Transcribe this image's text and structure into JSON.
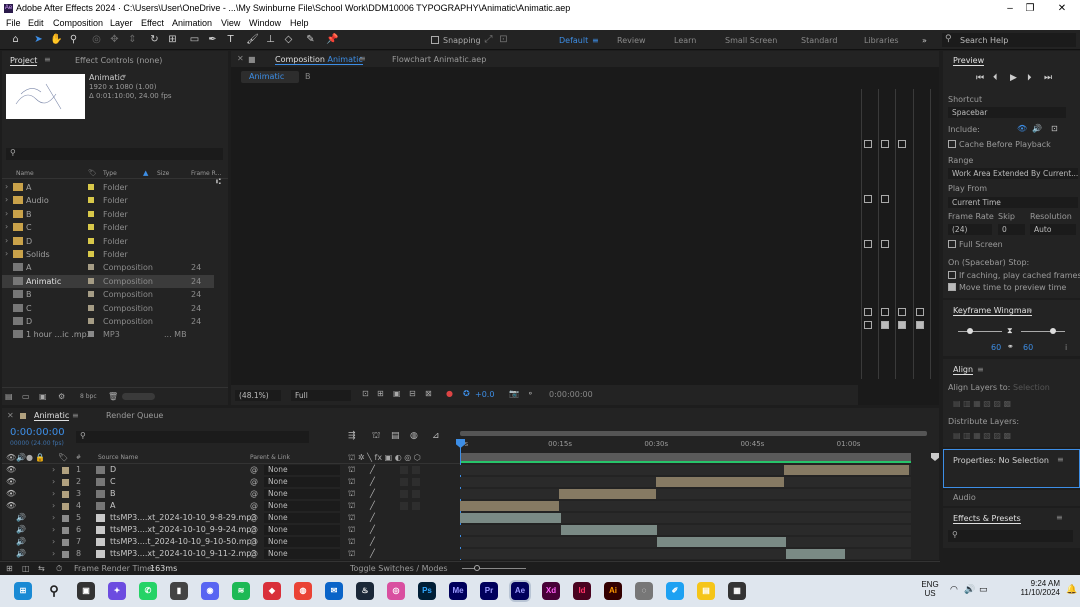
{
  "window": {
    "title": "Adobe After Effects 2024 · C:\\Users\\User\\OneDrive - ...\\My Swinburne File\\School Work\\DDM10006 TYPOGRAPHY\\Animatic\\Animatic.aep",
    "app_icon": "Ae"
  },
  "menu": [
    "File",
    "Edit",
    "Composition",
    "Layer",
    "Effect",
    "Animation",
    "View",
    "Window",
    "Help"
  ],
  "toolbar": {
    "snapping_label": "Snapping",
    "workspaces": [
      "Default",
      "Review",
      "Learn",
      "Small Screen",
      "Standard",
      "Libraries"
    ],
    "search_placeholder": "Search Help"
  },
  "project": {
    "tab_project": "Project",
    "tab_effect_controls": "Effect Controls (none)",
    "selected_name": "Animatic",
    "selected_size": "1920 x 1080 (1.00)",
    "selected_duration": "Δ 0:01:10:00, 24.00 fps",
    "columns": {
      "name": "Name",
      "type": "Type",
      "size": "Size",
      "frame_rate": "Frame R..."
    },
    "items": [
      {
        "name": "A",
        "type": "Folder",
        "rate": "",
        "size": "",
        "color": "#d8c84a",
        "kind": "folder"
      },
      {
        "name": "Audio",
        "type": "Folder",
        "rate": "",
        "size": "",
        "color": "#d8c84a",
        "kind": "folder"
      },
      {
        "name": "B",
        "type": "Folder",
        "rate": "",
        "size": "",
        "color": "#d8c84a",
        "kind": "folder"
      },
      {
        "name": "C",
        "type": "Folder",
        "rate": "",
        "size": "",
        "color": "#d8c84a",
        "kind": "folder"
      },
      {
        "name": "D",
        "type": "Folder",
        "rate": "",
        "size": "",
        "color": "#d8c84a",
        "kind": "folder"
      },
      {
        "name": "Solids",
        "type": "Folder",
        "rate": "",
        "size": "",
        "color": "#d8c84a",
        "kind": "folder"
      },
      {
        "name": "A",
        "type": "Composition",
        "rate": "24",
        "size": "",
        "color": "#a59c85",
        "kind": "comp"
      },
      {
        "name": "Animatic",
        "type": "Composition",
        "rate": "24",
        "size": "",
        "color": "#a59c85",
        "kind": "comp"
      },
      {
        "name": "B",
        "type": "Composition",
        "rate": "24",
        "size": "",
        "color": "#a59c85",
        "kind": "comp"
      },
      {
        "name": "C",
        "type": "Composition",
        "rate": "24",
        "size": "",
        "color": "#a59c85",
        "kind": "comp"
      },
      {
        "name": "D",
        "type": "Composition",
        "rate": "24",
        "size": "",
        "color": "#a59c85",
        "kind": "comp"
      },
      {
        "name": "1 hour ...ic .mp3",
        "type": "MP3",
        "rate": "",
        "size": "... MB",
        "color": "#8a8a8a",
        "kind": "audio"
      }
    ],
    "bpc": "8 bpc"
  },
  "composition": {
    "tab_label": "Composition",
    "tab_name": "Animatic",
    "flowchart_tab": "Flowchart Animatic.aep",
    "breadcrumb_active": "Animatic",
    "breadcrumb_next": "B",
    "zoom": "(48.1%)",
    "resolution": "Full",
    "exposure": "+0.0",
    "timecode": "0:00:00:00"
  },
  "preview": {
    "tab": "Preview",
    "shortcut_label": "Shortcut",
    "shortcut_value": "Spacebar",
    "include_label": "Include:",
    "cache_before": "Cache Before Playback",
    "range_label": "Range",
    "range_value": "Work Area Extended By Current...",
    "play_from_label": "Play From",
    "play_from_value": "Current Time",
    "frame_rate_label": "Frame Rate",
    "skip_label": "Skip",
    "resolution_label": "Resolution",
    "frame_rate_value": "(24)",
    "skip_value": "0",
    "resolution_value": "Auto",
    "full_screen": "Full Screen",
    "on_stop_label": "On (Spacebar) Stop:",
    "if_caching": "If caching, play cached frames",
    "move_time": "Move time to preview time"
  },
  "wingman": {
    "title": "Keyframe Wingman",
    "left_value": "60",
    "right_value": "60"
  },
  "align": {
    "title": "Align",
    "align_to_label": "Align Layers to:",
    "align_to_value": "Selection",
    "distribute_label": "Distribute Layers:"
  },
  "properties": {
    "title": "Properties: No Selection"
  },
  "audio": {
    "title": "Audio"
  },
  "effects": {
    "title": "Effects & Presets"
  },
  "timeline": {
    "tab": "Animatic",
    "render_queue": "Render Queue",
    "timecode": "0:00:00:00",
    "timecode_sub": "00000 (24.00 fps)",
    "columns": {
      "num": "#",
      "source": "Source Name",
      "parent": "Parent & Link"
    },
    "ruler": [
      "0s",
      "00:15s",
      "00:30s",
      "00:45s",
      "01:00s"
    ],
    "layers": [
      {
        "num": "1",
        "name": "D",
        "parent": "None",
        "color": "#b1a17f",
        "kind": "comp",
        "bar_start": 50.5,
        "bar_end": 70
      },
      {
        "num": "2",
        "name": "C",
        "parent": "None",
        "color": "#b1a17f",
        "kind": "comp",
        "bar_start": 30.5,
        "bar_end": 50.5
      },
      {
        "num": "3",
        "name": "B",
        "parent": "None",
        "color": "#b1a17f",
        "kind": "comp",
        "bar_start": 15.5,
        "bar_end": 30.5
      },
      {
        "num": "4",
        "name": "A",
        "parent": "None",
        "color": "#b1a17f",
        "kind": "comp",
        "bar_start": 0,
        "bar_end": 15.5
      },
      {
        "num": "5",
        "name": "ttsMP3....xt_2024-10-10_9-8-29.mp3",
        "parent": "None",
        "color": "#8c8c8c",
        "kind": "audio",
        "bar_start": 0,
        "bar_end": 15.8
      },
      {
        "num": "6",
        "name": "ttsMP3....xt_2024-10-10_9-9-24.mp3",
        "parent": "None",
        "color": "#8c8c8c",
        "kind": "audio",
        "bar_start": 15.8,
        "bar_end": 30.8
      },
      {
        "num": "7",
        "name": "ttsMP3....t_2024-10-10_9-10-50.mp3",
        "parent": "None",
        "color": "#8c8c8c",
        "kind": "audio",
        "bar_start": 30.8,
        "bar_end": 50.8
      },
      {
        "num": "8",
        "name": "ttsMP3....xt_2024-10-10_9-11-2.mp3",
        "parent": "None",
        "color": "#8c8c8c",
        "kind": "audio",
        "bar_start": 50.8,
        "bar_end": 60
      }
    ],
    "toggle_label": "Toggle Switches / Modes",
    "frame_render_label": "Frame Render Time:",
    "frame_render_value": "163ms"
  },
  "taskbar": {
    "apps": [
      "Ps",
      "Me",
      "Pr",
      "Ae",
      "Xd",
      "Id",
      "Ai"
    ],
    "lang_top": "ENG",
    "lang_bottom": "US",
    "time": "9:24 AM",
    "date": "11/10/2024"
  }
}
